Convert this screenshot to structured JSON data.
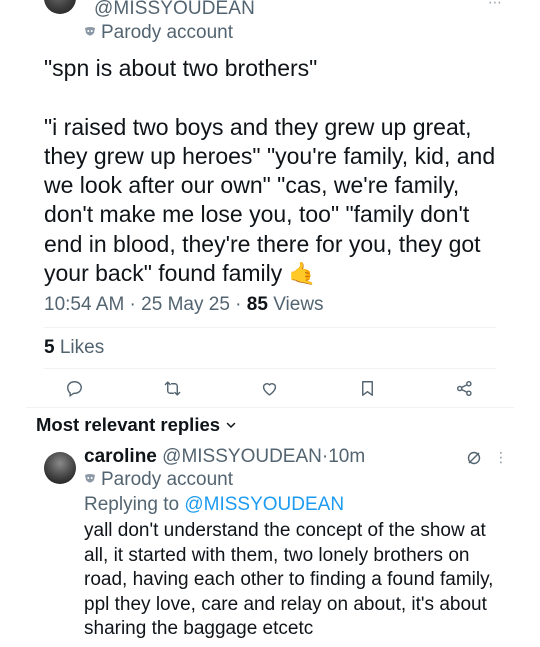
{
  "top_tweet": {
    "handle": "@MISSYOUDEAN",
    "parody_label": "Parody account",
    "text": "\"spn is about two brothers\"\n\n\"i raised two boys and they grew up great, they grew up heroes\" \"you're family, kid, and we look after our own\" \"cas, we're family, don't make me lose you, too\" \"family don't end in blood, they're there for you, they got your back\" found family",
    "emoji": "🤙",
    "time": "10:54 AM",
    "date": "25 May 25",
    "views_count": "85",
    "views_label": "Views",
    "likes_count": "5",
    "likes_label": "Likes"
  },
  "actions": [
    "reply-icon",
    "retweet-icon",
    "like-icon",
    "bookmark-icon",
    "share-icon"
  ],
  "replies_sort": {
    "label": "Most relevant replies"
  },
  "reply": {
    "name": "caroline",
    "handle": "@MISSYOUDEAN",
    "separator": "·",
    "age": "10m",
    "parody_label": "Parody account",
    "replying_prefix": "Replying to",
    "replying_to": "@MISSYOUDEAN",
    "text": "yall don't understand the concept of the show at all, it started with them, two lonely brothers on road, having each other to finding a found family, ppl they love, care and relay on about, it's about sharing the baggage etcetc"
  },
  "colors": {
    "text_primary": "#0f1419",
    "text_secondary": "#536471",
    "link": "#1d9bf0",
    "divider": "#eff3f4"
  }
}
